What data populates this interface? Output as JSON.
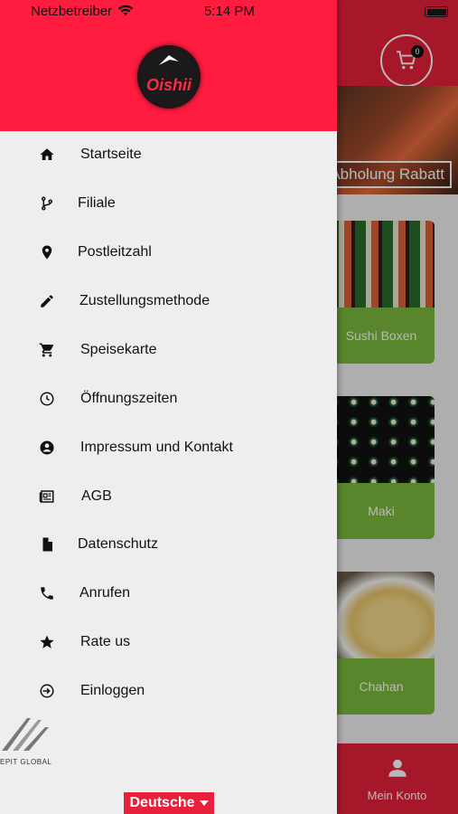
{
  "status_bar": {
    "carrier": "Netzbetreiber",
    "time": "5:14 PM"
  },
  "header": {
    "cart_count": "0",
    "logo_text": "Oishii"
  },
  "banner": {
    "label": "Abholung Rabatt"
  },
  "categories": [
    {
      "label": "Sushi Boxen"
    },
    {
      "label": "Maki"
    },
    {
      "label": "Chahan"
    }
  ],
  "bottom_nav": {
    "account_label": "Mein Konto"
  },
  "menu": {
    "items": [
      {
        "label": "Startseite",
        "icon": "home-icon"
      },
      {
        "label": "Filiale",
        "icon": "branch-icon"
      },
      {
        "label": "Postleitzahl",
        "icon": "location-pin-icon"
      },
      {
        "label": "Zustellungsmethode",
        "icon": "pencil-icon"
      },
      {
        "label": "Speisekarte",
        "icon": "cart-icon"
      },
      {
        "label": "Öffnungszeiten",
        "icon": "clock-icon"
      },
      {
        "label": "Impressum und Kontakt",
        "icon": "account-circle-icon"
      },
      {
        "label": "AGB",
        "icon": "newspaper-icon"
      },
      {
        "label": "Datenschutz",
        "icon": "document-icon"
      },
      {
        "label": "Anrufen",
        "icon": "phone-icon"
      },
      {
        "label": "Rate us",
        "icon": "star-icon"
      },
      {
        "label": "Einloggen",
        "icon": "login-icon"
      }
    ]
  },
  "footer": {
    "brand": "EPIT GLOBAL",
    "language": "Deutsche"
  },
  "colors": {
    "brand_red": "#ff1c3f",
    "category_green": "#7cba3e"
  }
}
